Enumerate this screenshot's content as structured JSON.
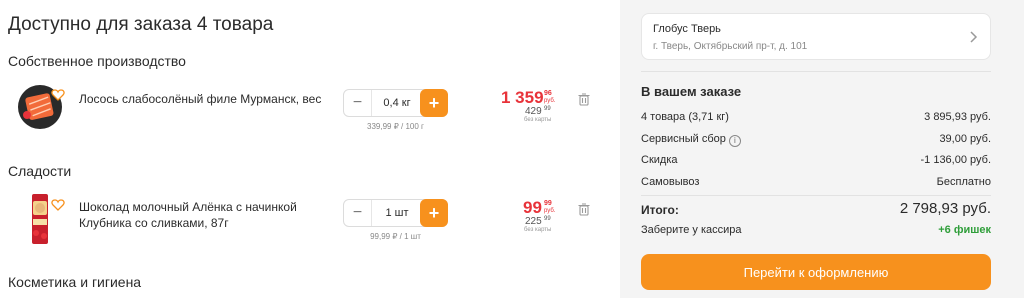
{
  "cart": {
    "title": "Доступно для заказа 4 товара",
    "sections": [
      {
        "title": "Собственное производство",
        "item": {
          "name": "Лосось слабосолёный филе Мурманск, вес",
          "quantity": "0,4 кг",
          "unit_price": "339,99 ₽ / 100 г",
          "price_main": "1 359",
          "price_cents": "96",
          "currency": "руб.",
          "old_price_main": "429",
          "old_price_cents": "99",
          "old_price_note": "без карты",
          "minus_icon": "minus-icon",
          "plus_icon": "plus-icon",
          "delete_icon": "trash-icon"
        }
      },
      {
        "title": "Сладости",
        "item": {
          "name_line1": "Шоколад молочный Алёнка с начинкой",
          "name_line2": "Клубника со сливками, 87г",
          "quantity": "1 шт",
          "unit_price": "99,99 ₽ / 1 шт",
          "price_main": "99",
          "price_cents": "99",
          "currency": "руб.",
          "old_price_main": "225",
          "old_price_cents": "99",
          "old_price_note": "без карты",
          "minus_icon": "minus-icon",
          "plus_icon": "plus-icon",
          "delete_icon": "trash-icon"
        }
      },
      {
        "title": "Косметика и гигиена"
      }
    ]
  },
  "store": {
    "name": "Глобус Тверь",
    "address": "г. Тверь, Октябрьский пр-т, д. 101",
    "chevron_icon": "chevron-right-icon"
  },
  "summary": {
    "title": "В вашем заказе",
    "rows": [
      {
        "label": "4 товара (3,71 кг)",
        "value": "3 895,93 руб."
      },
      {
        "label": "Сервисный сбор",
        "value": "39,00 руб.",
        "icon": "info-icon"
      },
      {
        "label": "Скидка",
        "value": "-1 136,00 руб."
      },
      {
        "label": "Самовывоз",
        "value": "Бесплатно"
      }
    ],
    "total_label": "Итого:",
    "total_value": "2 798,93 руб.",
    "cashier_label": "Заберите у кассира",
    "bonus_value": "+6 фишек",
    "info_glyph": "i"
  },
  "checkout": {
    "label": "Перейти к оформлению"
  },
  "colors": {
    "accent": "#f7911d",
    "price_red": "#e8333a",
    "bonus_green": "#2f9e3a",
    "sidebar_bg": "#f4f4f4"
  }
}
